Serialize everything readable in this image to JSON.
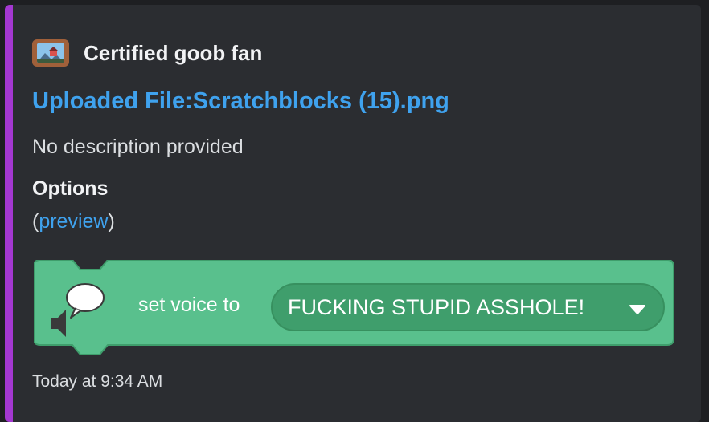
{
  "embed": {
    "accent_color": "#a438d1",
    "author": {
      "icon": "framed-picture-icon",
      "name": "Certified goob fan"
    },
    "title": "Uploaded File:Scratchblocks (15).png",
    "description": "No description provided",
    "field": {
      "name": "Options",
      "open_paren": "(",
      "link_text": "preview",
      "close_paren": ")"
    },
    "image": {
      "block_color": "#59c08d",
      "speech_icon": "speech-bubble-icon",
      "speaker_icon": "speaker-icon",
      "label": "set voice to",
      "dropdown_value": "FUCKING STUPID ASSHOLE!",
      "dropdown_icon": "triangle-down-icon"
    },
    "timestamp": "Today at 9:34 AM"
  }
}
